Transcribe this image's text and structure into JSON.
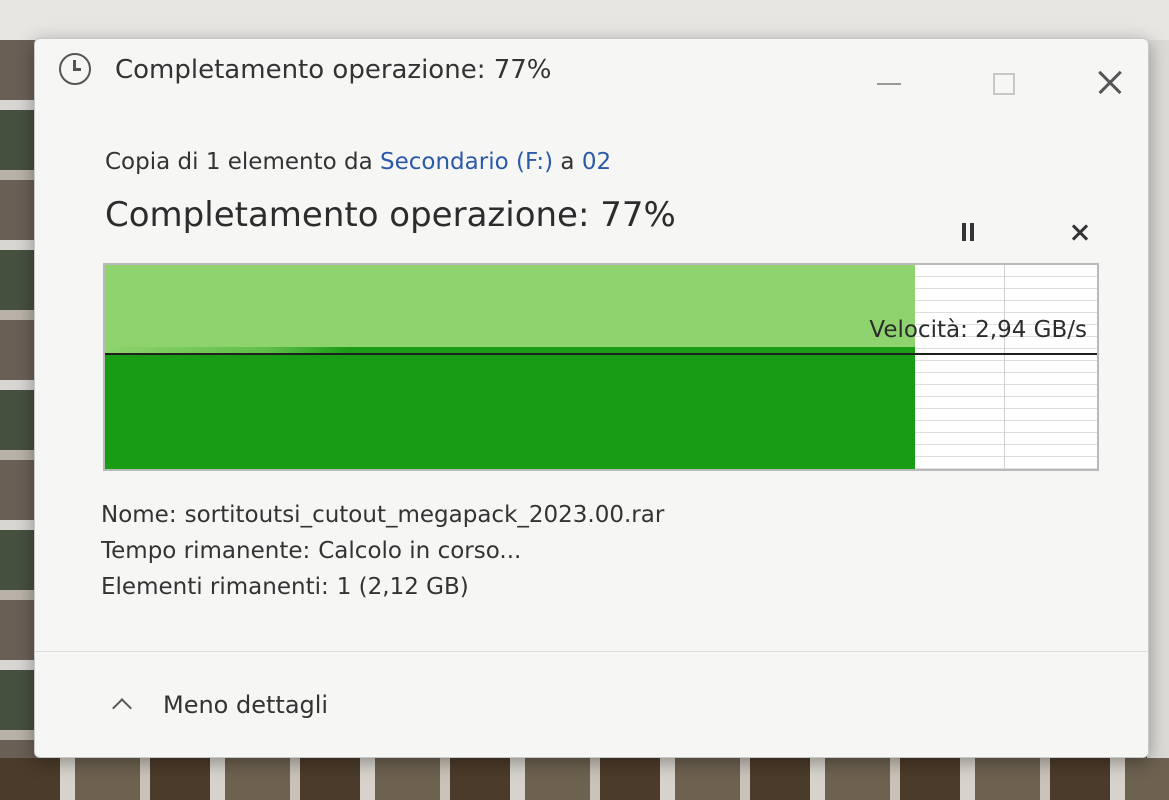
{
  "window": {
    "title": "Completamento operazione: 77%"
  },
  "operation": {
    "prefix": "Copia di 1 elemento da ",
    "source": "Secondario (F:)",
    "connector": " a ",
    "destination": "02",
    "heading": "Completamento operazione: 77%",
    "progress_fraction": 0.77
  },
  "graph": {
    "speed_label": "Velocità: 2,94 GB/s"
  },
  "details": {
    "name_label": "Nome:",
    "name_value": "sortitoutsi_cutout_megapack_2023.00.rar",
    "time_label": "Tempo rimanente:",
    "time_value": "Calcolo in corso...",
    "items_label": "Elementi rimanenti:",
    "items_value": "1 (2,12 GB)"
  },
  "footer": {
    "toggle_label": "Meno dettagli"
  },
  "icons": {
    "title": "clock-icon",
    "pause": "pause-icon",
    "cancel": "close-icon",
    "toggle": "chevron-up-icon"
  },
  "colors": {
    "progress_light": "#8ed36d",
    "progress_dark": "#189b15",
    "link": "#2a5aa8"
  }
}
